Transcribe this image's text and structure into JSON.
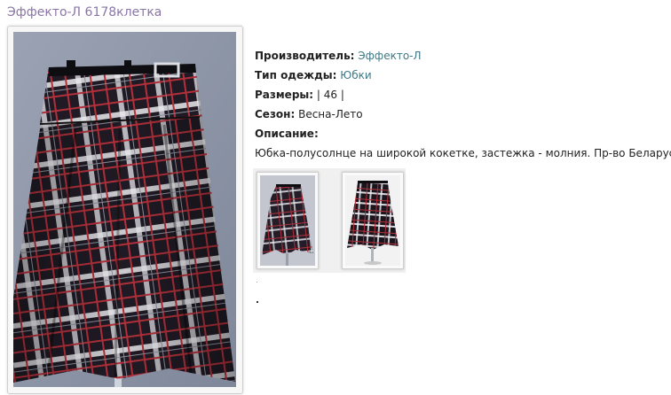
{
  "product": {
    "title": "Эффекто-Л 6178клетка",
    "fields": {
      "manufacturer_label": "Производитель:",
      "manufacturer_value": "Эффекто-Л",
      "type_label": "Тип одежды:",
      "type_value": "Юбки",
      "sizes_label": "Размеры:",
      "sizes_value": "| 46 |",
      "season_label": "Сезон:",
      "season_value": "Весна-Лето",
      "description_label": "Описание:",
      "description_value": "Юбка-полусолнце на широкой кокетке, застежка - молния. Пр-во Беларусь"
    }
  },
  "images": {
    "main": "plaid-skirt-photo",
    "thumbnails": [
      "plaid-skirt-thumbnail-1",
      "plaid-skirt-thumbnail-2"
    ]
  },
  "colors": {
    "title": "#8a75a8",
    "link": "#3d7a86",
    "plaid_dark": "#1f1a24",
    "plaid_red": "#b2303a",
    "plaid_white": "#e9e9ee"
  }
}
